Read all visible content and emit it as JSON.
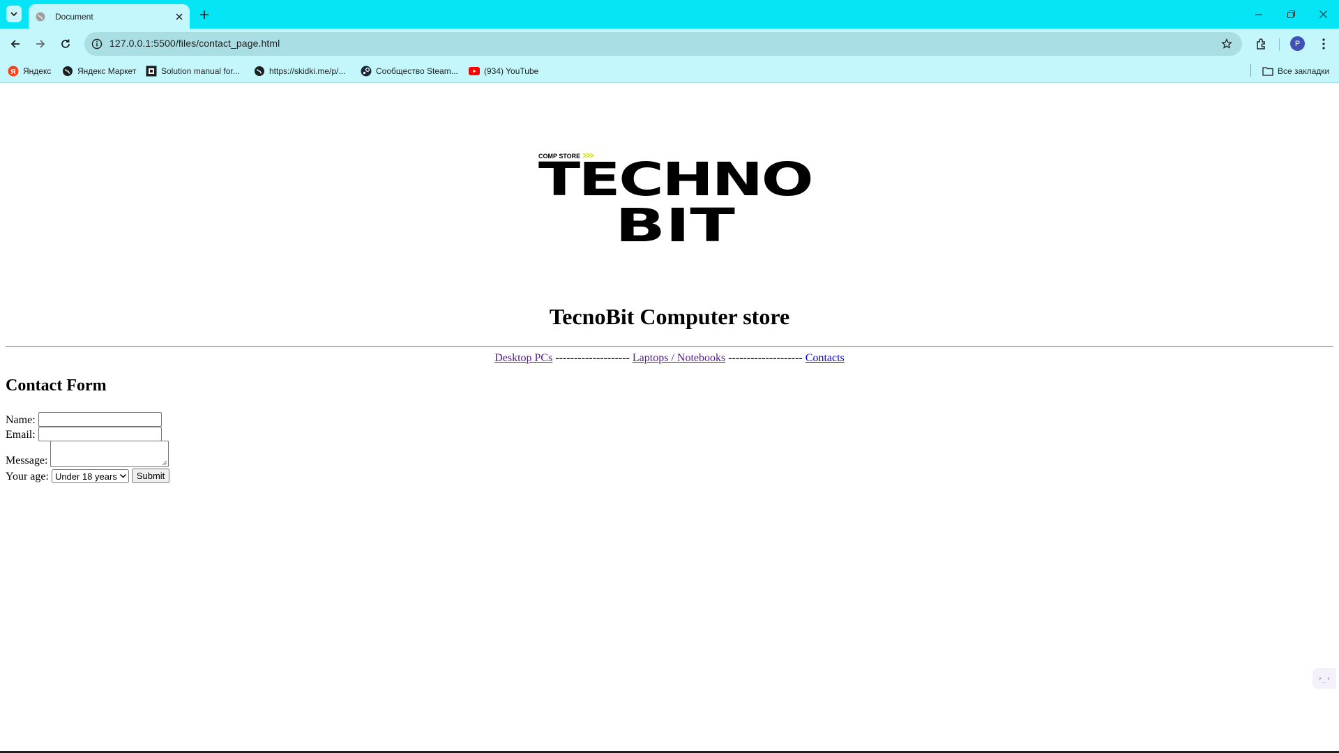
{
  "browser": {
    "tab": {
      "title": "Document"
    },
    "address_bar": {
      "url": "127.0.0.1:5500/files/contact_page.html"
    },
    "profile_initial": "P",
    "bookmarks": [
      {
        "label": "Яндекс",
        "icon": "yandex-icon"
      },
      {
        "label": "Яндекс Маркет",
        "icon": "globe-icon"
      },
      {
        "label": "Solution manual for...",
        "icon": "site-icon"
      },
      {
        "label": "https://skidki.me/p/...",
        "icon": "globe-icon"
      },
      {
        "label": "Сообщество Steam...",
        "icon": "steam-icon"
      },
      {
        "label": "(934) YouTube",
        "icon": "youtube-icon"
      }
    ],
    "all_bookmarks_label": "Все закладки",
    "accent_color": "#06e5f5"
  },
  "page": {
    "logo": {
      "small_text": "COMP STORE",
      "line1": "TECHNO",
      "line2": "BIT"
    },
    "title": "TecnoBit Computer store",
    "nav": {
      "items": [
        {
          "label": "Desktop PCs"
        },
        {
          "label": "Laptops / Notebooks"
        },
        {
          "label": "Contacts"
        }
      ],
      "separator": "--------------------"
    },
    "form": {
      "heading": "Contact Form",
      "name_label": "Name:",
      "name_value": "",
      "email_label": "Email:",
      "email_value": "",
      "message_label": "Message:",
      "message_value": "",
      "age_label": "Your age:",
      "age_selected": "Under 18 years",
      "submit_label": "Submit"
    },
    "side_widget_text": "›_‹"
  }
}
